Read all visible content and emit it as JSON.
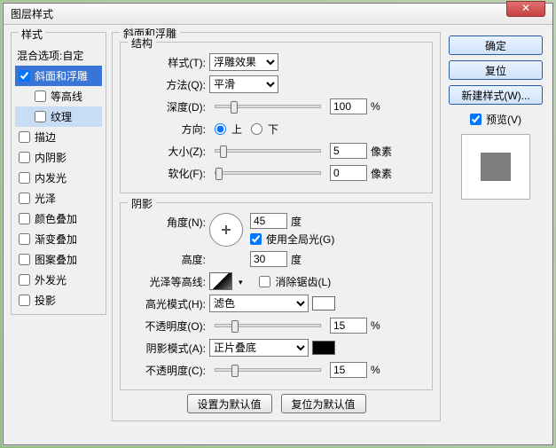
{
  "title": "图层样式",
  "left": {
    "header": "样式",
    "blend": "混合选项:自定",
    "items": [
      {
        "label": "斜面和浮雕",
        "checked": true,
        "selected": true,
        "sub": false
      },
      {
        "label": "等高线",
        "checked": false,
        "selected": false,
        "sub": true
      },
      {
        "label": "纹理",
        "checked": false,
        "selected": false,
        "sub": true,
        "subsel": true
      },
      {
        "label": "描边",
        "checked": false,
        "selected": false,
        "sub": false
      },
      {
        "label": "内阴影",
        "checked": false,
        "selected": false,
        "sub": false
      },
      {
        "label": "内发光",
        "checked": false,
        "selected": false,
        "sub": false
      },
      {
        "label": "光泽",
        "checked": false,
        "selected": false,
        "sub": false
      },
      {
        "label": "颜色叠加",
        "checked": false,
        "selected": false,
        "sub": false
      },
      {
        "label": "渐变叠加",
        "checked": false,
        "selected": false,
        "sub": false
      },
      {
        "label": "图案叠加",
        "checked": false,
        "selected": false,
        "sub": false
      },
      {
        "label": "外发光",
        "checked": false,
        "selected": false,
        "sub": false
      },
      {
        "label": "投影",
        "checked": false,
        "selected": false,
        "sub": false
      }
    ]
  },
  "mid": {
    "group1_title": "斜面和浮雕",
    "structure_title": "结构",
    "style_label": "样式(T):",
    "style_value": "浮雕效果",
    "method_label": "方法(Q):",
    "method_value": "平滑",
    "depth_label": "深度(D):",
    "depth_value": "100",
    "depth_unit": "%",
    "direction_label": "方向:",
    "dir_up": "上",
    "dir_down": "下",
    "size_label": "大小(Z):",
    "size_value": "5",
    "size_unit": "像素",
    "soft_label": "软化(F):",
    "soft_value": "0",
    "soft_unit": "像素",
    "shading_title": "阴影",
    "angle_label": "角度(N):",
    "angle_value": "45",
    "angle_unit": "度",
    "global_label": "使用全局光(G)",
    "altitude_label": "高度:",
    "altitude_value": "30",
    "altitude_unit": "度",
    "gloss_label": "光泽等高线:",
    "antialias_label": "消除锯齿(L)",
    "hilite_mode_label": "高光模式(H):",
    "hilite_mode_value": "滤色",
    "hilite_op_label": "不透明度(O):",
    "hilite_op_value": "15",
    "hilite_op_unit": "%",
    "shadow_mode_label": "阴影模式(A):",
    "shadow_mode_value": "正片叠底",
    "shadow_op_label": "不透明度(C):",
    "shadow_op_value": "15",
    "shadow_op_unit": "%",
    "btn_default": "设置为默认值",
    "btn_reset": "复位为默认值"
  },
  "right": {
    "ok": "确定",
    "cancel": "复位",
    "new_style": "新建样式(W)...",
    "preview_label": "预览(V)"
  }
}
